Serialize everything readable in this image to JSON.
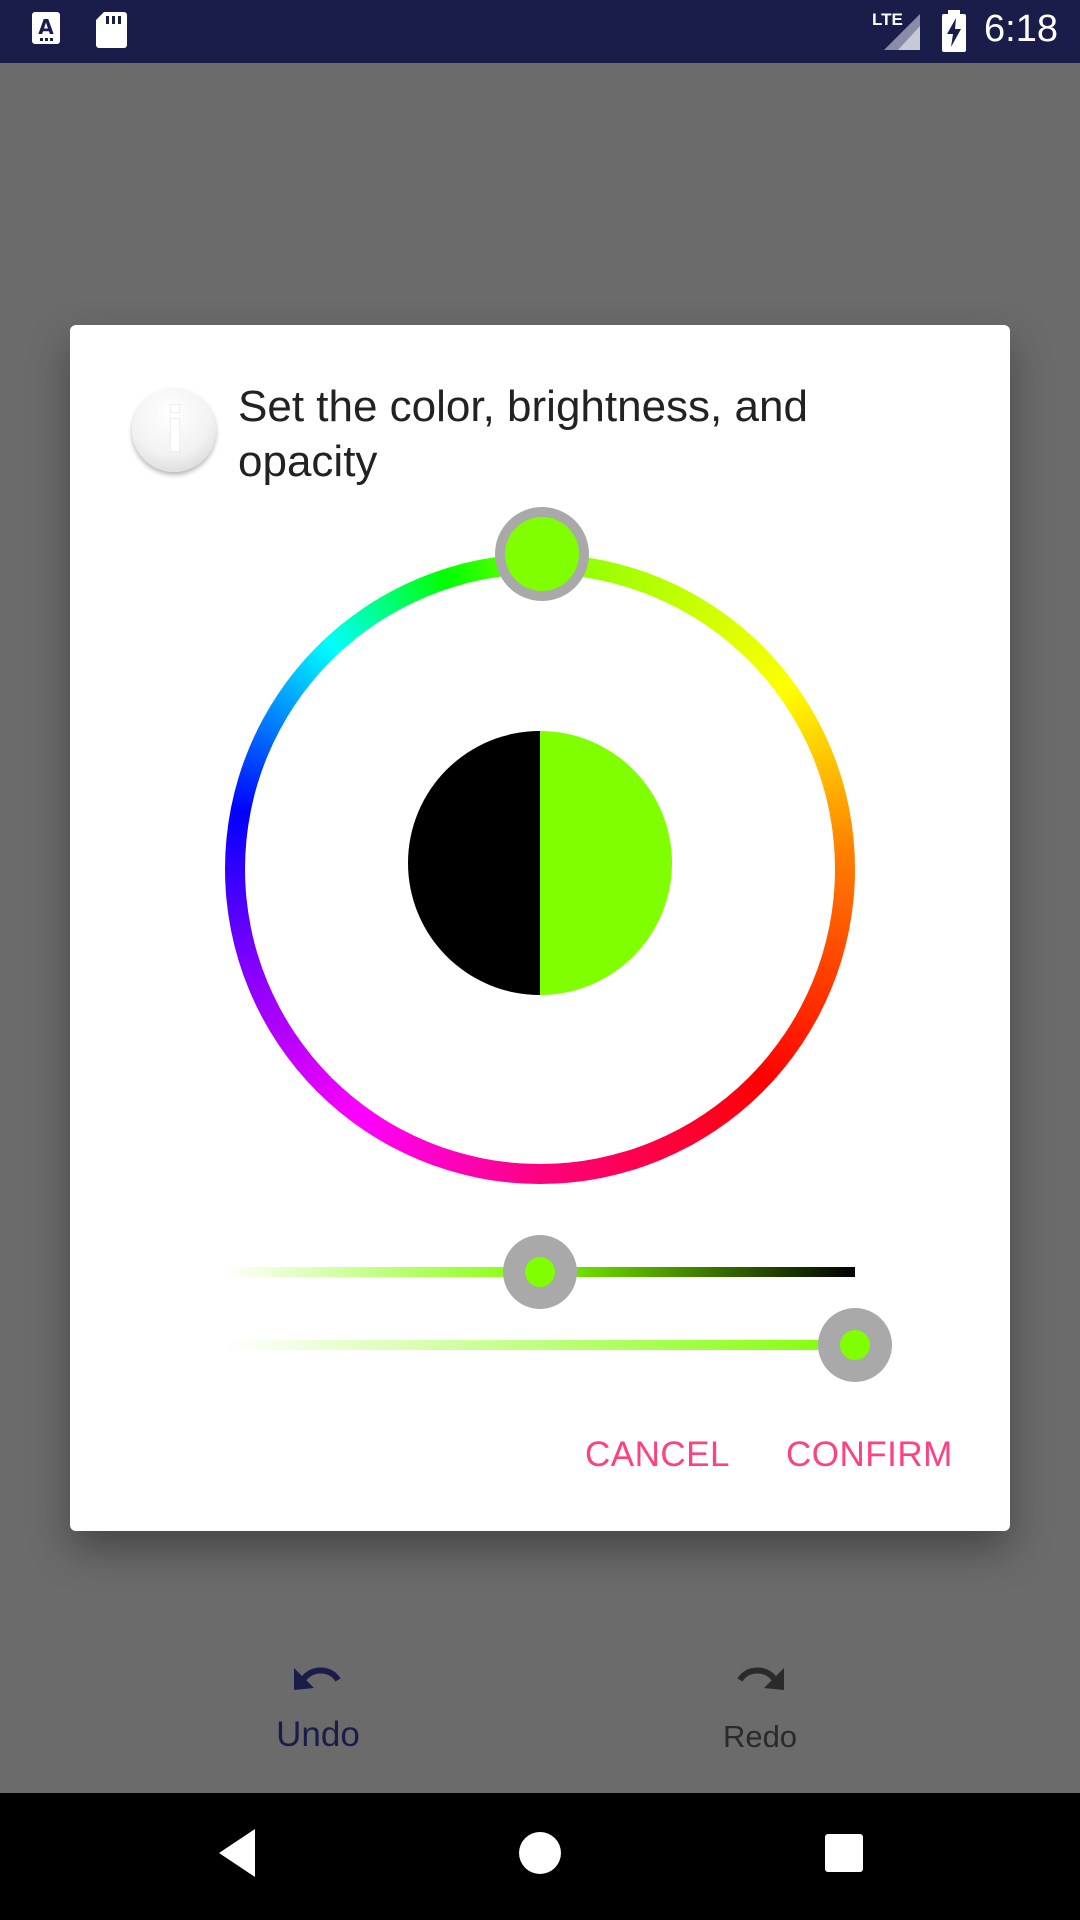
{
  "status_bar": {
    "time": "6:18",
    "network": "LTE",
    "icons": [
      "font-app-icon",
      "sd-card-icon",
      "signal-icon",
      "battery-charging-icon"
    ]
  },
  "dialog": {
    "title": "Set the color, brightness, and opacity",
    "icon": "info-icon",
    "selected_color": "#80ff00",
    "previous_color": "#000000",
    "brightness_level_percent": 50,
    "opacity_level_percent": 100,
    "cancel_label": "CANCEL",
    "confirm_label": "CONFIRM",
    "accent_color": "#ff4081"
  },
  "bottom_actions": {
    "undo_label": "Undo",
    "redo_label": "Redo"
  },
  "nav_bar": {
    "icons": [
      "back-icon",
      "home-icon",
      "recents-icon"
    ]
  }
}
